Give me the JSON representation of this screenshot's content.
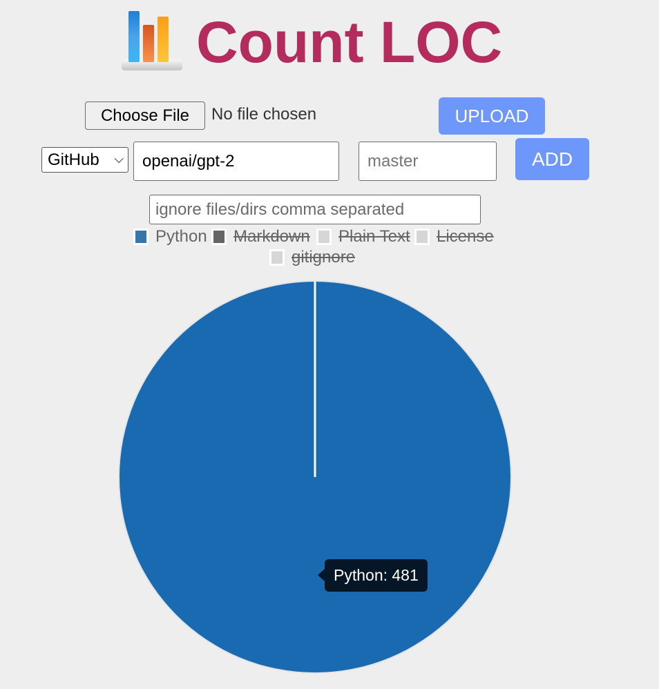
{
  "app": {
    "title": "Count LOC",
    "logo_icon": "bar-chart-icon"
  },
  "upload": {
    "choose_file_label": "Choose File",
    "file_status": "No file chosen",
    "upload_label": "UPLOAD"
  },
  "repo": {
    "source_selected": "GitHub",
    "source_chevron": "⌵",
    "repo_value": "openai/gpt-2",
    "branch_placeholder": "master",
    "add_label": "ADD"
  },
  "ignore": {
    "placeholder": "ignore files/dirs comma separated"
  },
  "colors": {
    "title": "#b42b5e",
    "button": "#6e97fb",
    "python": "#1a6ab1",
    "tooltip_bg": "#051627"
  },
  "chart_data": {
    "type": "pie",
    "title": "",
    "legend_position": "top",
    "legend": [
      {
        "label": "Python",
        "color": "#3776ab",
        "hidden": false
      },
      {
        "label": "Markdown",
        "color": "#666666",
        "hidden": true
      },
      {
        "label": "Plain Text",
        "color": "#d6d6d6",
        "hidden": true
      },
      {
        "label": "License",
        "color": "#d6d6d6",
        "hidden": true
      },
      {
        "label": "gitignore",
        "color": "#d6d6d6",
        "hidden": true
      }
    ],
    "slices": [
      {
        "label": "Python",
        "value": 481,
        "color": "#1a6ab1"
      }
    ],
    "tooltip": {
      "label": "Python",
      "value": 481,
      "text": "Python: 481"
    }
  }
}
